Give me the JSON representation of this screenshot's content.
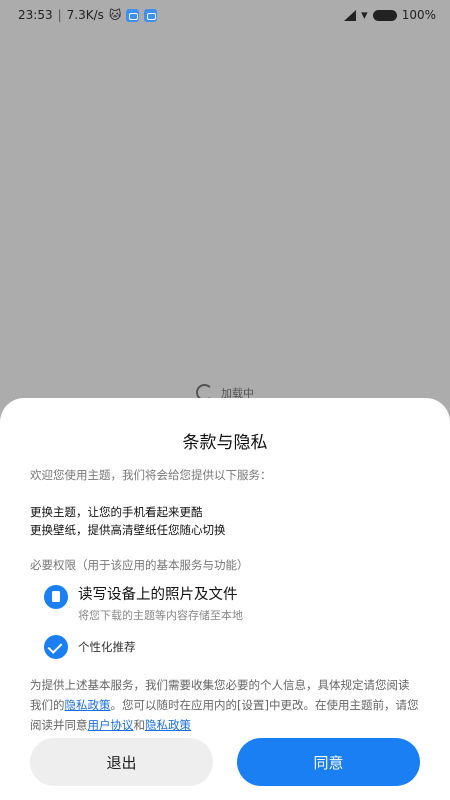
{
  "status_bar": {
    "time": "23:53",
    "speed": "7.3K/s",
    "battery": "100%"
  },
  "background": {
    "loading_text": "加载中"
  },
  "dialog": {
    "title": "条款与隐私",
    "intro": "欢迎您使用主题，我们将会给您提供以下服务：",
    "services": [
      "更换主题，让您的手机看起来更酷",
      "更换壁纸，提供高清壁纸任您随心切换"
    ],
    "permissions_header": "必要权限（用于该应用的基本服务与功能）",
    "permissions": [
      {
        "title": "读写设备上的照片及文件",
        "description": "将您下载的主题等内容存储至本地",
        "checked": true
      },
      {
        "title": "个性化推荐",
        "checked": true
      }
    ],
    "policy": {
      "part1": "为提供上述基本服务，我们需要收集您必要的个人信息，具体规定请您阅读我们的",
      "link1": "隐私政策",
      "part2": "。您可以随时在应用内的[设置]中更改。在使用主题前，请您阅读并同意",
      "link2": "用户协议",
      "part3": "和",
      "link3": "隐私政策"
    },
    "buttons": {
      "exit": "退出",
      "agree": "同意"
    }
  },
  "colors": {
    "accent": "#1a7ff3",
    "backdrop": "#acacac"
  }
}
